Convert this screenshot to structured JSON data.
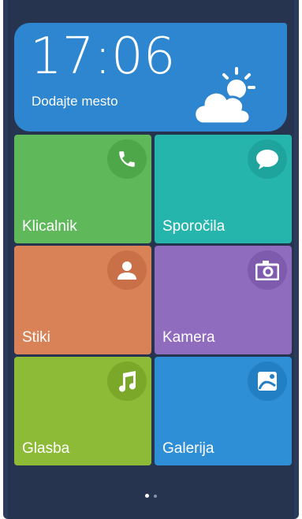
{
  "widget": {
    "time": "17:06",
    "location": "Dodajte mesto",
    "weather_icon": "partly-sunny-icon"
  },
  "tiles": [
    {
      "label": "Klicalnik",
      "icon": "phone-icon",
      "color": "#5fb85a"
    },
    {
      "label": "Sporočila",
      "icon": "message-icon",
      "color": "#26b5ad"
    },
    {
      "label": "Stiki",
      "icon": "contact-icon",
      "color": "#d98258"
    },
    {
      "label": "Kamera",
      "icon": "camera-icon",
      "color": "#8f6cbd"
    },
    {
      "label": "Glasba",
      "icon": "music-icon",
      "color": "#8dba37"
    },
    {
      "label": "Galerija",
      "icon": "gallery-icon",
      "color": "#2f8fd6"
    }
  ],
  "pager": {
    "pages": 2,
    "current": 1
  }
}
